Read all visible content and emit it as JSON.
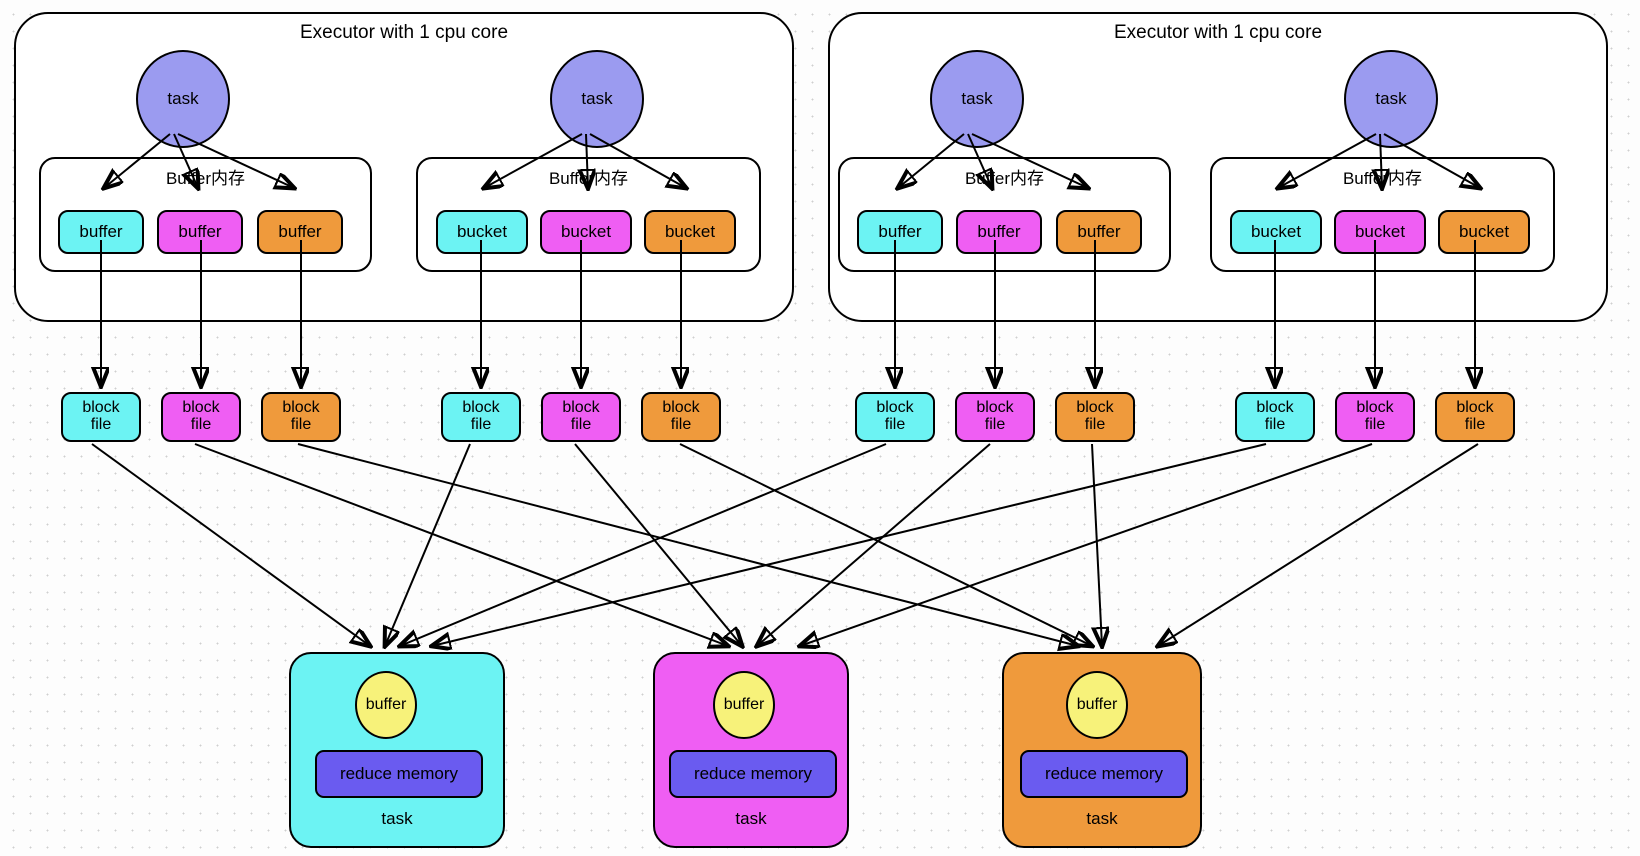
{
  "diagram": {
    "title_text": "Executor with 1 cpu core",
    "buffer_group_title": "Buffer内存",
    "task_label": "task",
    "buffer_label": "buffer",
    "bucket_label": "bucket",
    "block_file_line1": "block",
    "block_file_line2": "file",
    "reduce_memory_label": "reduce memory",
    "reduce_buffer_label": "buffer",
    "reduce_task_label": "task"
  },
  "colors": {
    "cyan": "#6cf3f3",
    "magenta": "#ef5ef3",
    "orange": "#ef9a3c",
    "task_purple": "#9b9bf0",
    "reduce_memory_blue": "#6a5bf0",
    "buffer_yellow": "#f7f27a",
    "stroke": "#000000",
    "background": "#fdfdfd"
  },
  "executors": [
    {
      "title": "Executor with 1 cpu core",
      "groups": [
        {
          "title": "Buffer内存",
          "task": "task",
          "slots": [
            {
              "label": "buffer",
              "color": "cyan"
            },
            {
              "label": "buffer",
              "color": "magenta"
            },
            {
              "label": "buffer",
              "color": "orange"
            }
          ]
        },
        {
          "title": "Buffer内存",
          "task": "task",
          "slots": [
            {
              "label": "bucket",
              "color": "cyan"
            },
            {
              "label": "bucket",
              "color": "magenta"
            },
            {
              "label": "bucket",
              "color": "orange"
            }
          ]
        }
      ]
    },
    {
      "title": "Executor with 1 cpu core",
      "groups": [
        {
          "title": "Buffer内存",
          "task": "task",
          "slots": [
            {
              "label": "buffer",
              "color": "cyan"
            },
            {
              "label": "buffer",
              "color": "magenta"
            },
            {
              "label": "buffer",
              "color": "orange"
            }
          ]
        },
        {
          "title": "Buffer内存",
          "task": "task",
          "slots": [
            {
              "label": "bucket",
              "color": "cyan"
            },
            {
              "label": "bucket",
              "color": "magenta"
            },
            {
              "label": "bucket",
              "color": "orange"
            }
          ]
        }
      ]
    }
  ],
  "block_files": [
    {
      "line1": "block",
      "line2": "file",
      "color": "cyan"
    },
    {
      "line1": "block",
      "line2": "file",
      "color": "magenta"
    },
    {
      "line1": "block",
      "line2": "file",
      "color": "orange"
    },
    {
      "line1": "block",
      "line2": "file",
      "color": "cyan"
    },
    {
      "line1": "block",
      "line2": "file",
      "color": "magenta"
    },
    {
      "line1": "block",
      "line2": "file",
      "color": "orange"
    },
    {
      "line1": "block",
      "line2": "file",
      "color": "cyan"
    },
    {
      "line1": "block",
      "line2": "file",
      "color": "magenta"
    },
    {
      "line1": "block",
      "line2": "file",
      "color": "orange"
    },
    {
      "line1": "block",
      "line2": "file",
      "color": "cyan"
    },
    {
      "line1": "block",
      "line2": "file",
      "color": "magenta"
    },
    {
      "line1": "block",
      "line2": "file",
      "color": "orange"
    }
  ],
  "reduce_tasks": [
    {
      "color": "cyan",
      "buffer": "buffer",
      "memory": "reduce memory",
      "label": "task"
    },
    {
      "color": "magenta",
      "buffer": "buffer",
      "memory": "reduce memory",
      "label": "task"
    },
    {
      "color": "orange",
      "buffer": "buffer",
      "memory": "reduce memory",
      "label": "task"
    }
  ]
}
